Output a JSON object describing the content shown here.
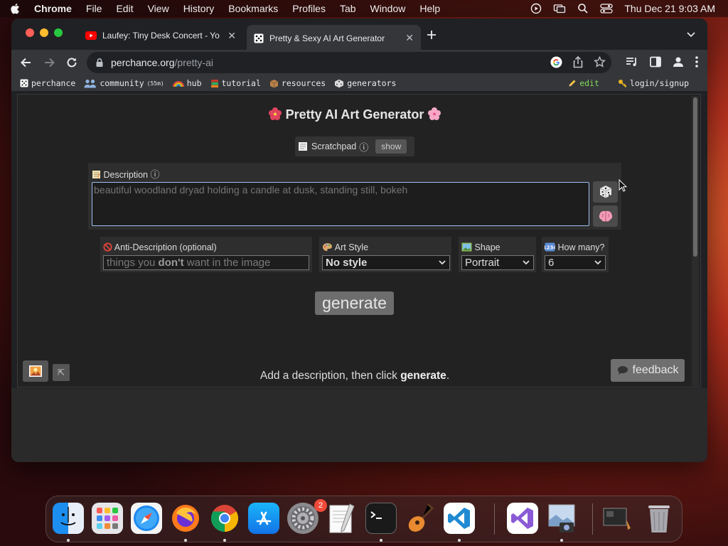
{
  "menubar": {
    "app_name": "Chrome",
    "items": [
      "File",
      "Edit",
      "View",
      "History",
      "Bookmarks",
      "Profiles",
      "Tab",
      "Window",
      "Help"
    ],
    "datetime": "Thu Dec 21  9:03 AM"
  },
  "tabs": [
    {
      "title": "Laufey: Tiny Desk Concert - Yo",
      "icon": "youtube-icon"
    },
    {
      "title": "Pretty & Sexy AI Art Generator",
      "icon": "perchance-dice-icon"
    }
  ],
  "omnibox": {
    "host": "perchance.org",
    "path": "/pretty-ai"
  },
  "bookmarks": {
    "items": [
      {
        "label": "perchance",
        "icon": "dice-icon"
      },
      {
        "label": "community",
        "note": "(55m)",
        "icon": "people-icon"
      },
      {
        "label": "hub",
        "icon": "rainbow-icon"
      },
      {
        "label": "tutorial",
        "icon": "books-icon"
      },
      {
        "label": "resources",
        "icon": "box-icon"
      },
      {
        "label": "generators",
        "icon": "dice-icon"
      }
    ],
    "edit": "edit",
    "login": "login/signup"
  },
  "page": {
    "title": "Pretty AI Art Generator",
    "scratchpad": {
      "label": "Scratchpad",
      "info": "ⓘ",
      "button": "show"
    },
    "description": {
      "label": "Description",
      "info": "ⓘ",
      "placeholder": "beautiful woodland dryad holding a candle at dusk, standing still, bokeh"
    },
    "anti_description": {
      "label": "Anti-Description (optional)",
      "placeholder_pre": "things you ",
      "placeholder_bold": "don't",
      "placeholder_post": " want in the image"
    },
    "art_style": {
      "label": "Art Style",
      "value": "No style"
    },
    "shape": {
      "label": "Shape",
      "value": "Portrait"
    },
    "how_many": {
      "label": "How many?",
      "value": "6"
    },
    "generate": "generate",
    "status": {
      "pre": "Add a description, then click ",
      "bold": "generate",
      "post": "."
    },
    "feedback": "feedback"
  },
  "dock": {
    "apps": [
      "Finder",
      "Launchpad",
      "Safari",
      "Firefox",
      "Chrome",
      "App Store",
      "System Settings",
      "TextEdit",
      "Terminal",
      "GarageBand",
      "Visual Studio Code",
      "Visual Studio",
      "Preview",
      "Screenshot",
      "Trash"
    ],
    "settings_badge": "2"
  },
  "colors": {
    "accent_focus": "#9cc0f0",
    "edit_link": "#7fdb5b",
    "page_bg": "#222222"
  }
}
